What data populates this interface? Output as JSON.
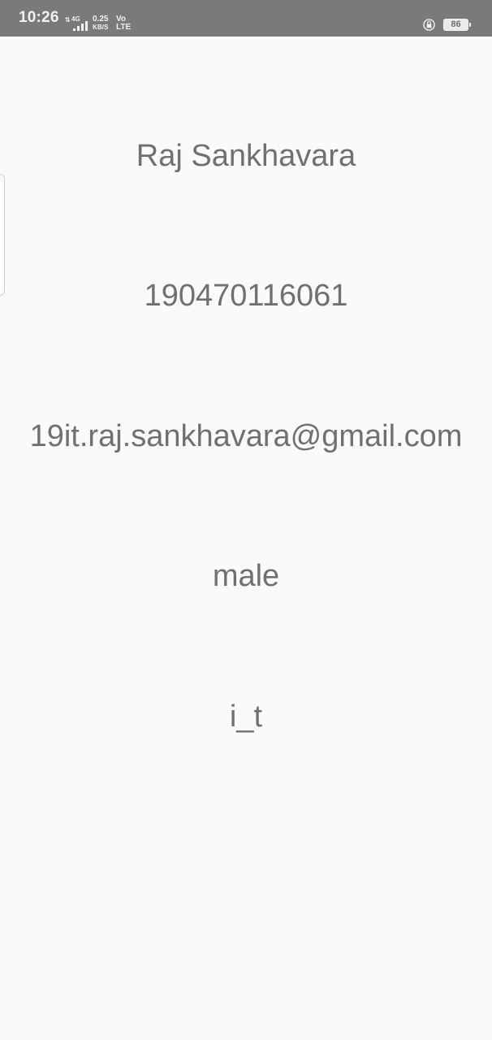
{
  "status_bar": {
    "time": "10:26",
    "network_small": "⇅",
    "network_4g": "4G",
    "speed_value": "0.25",
    "speed_unit": "KB/S",
    "volte_top": "Vo",
    "volte_bottom": "LTE",
    "battery_level": "86",
    "icons": [
      "signal-icon",
      "lock-icon",
      "battery-icon"
    ]
  },
  "profile": {
    "name": "Raj Sankhavara",
    "id": "190470116061",
    "email": "19it.raj.sankhavara@gmail.com",
    "gender": "male",
    "department": "i_t"
  },
  "colors": {
    "status_bar_bg": "#7a7a7a",
    "page_bg": "#fafafa",
    "text": "#707070"
  }
}
